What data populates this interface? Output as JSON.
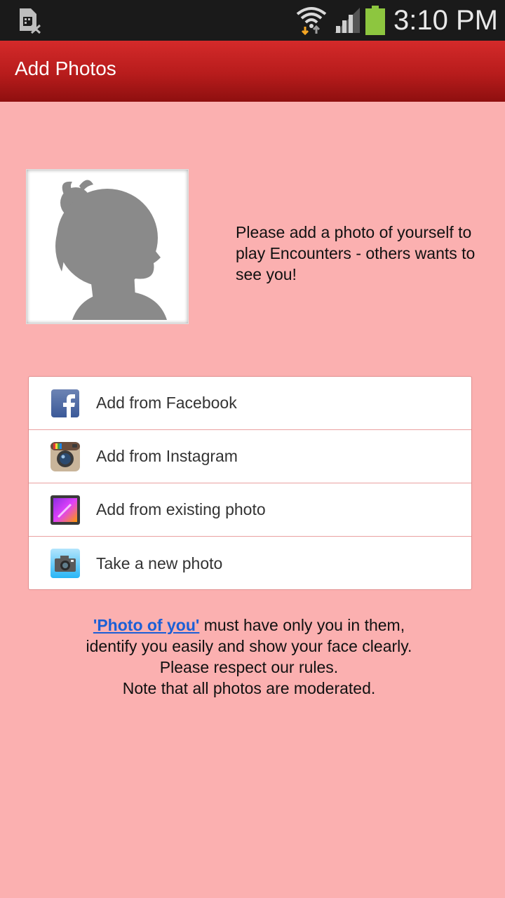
{
  "status_bar": {
    "time": "3:10 PM",
    "icons": [
      "sim-card-error-icon",
      "wifi-icon",
      "signal-icon",
      "battery-icon"
    ],
    "battery_color": "#8dc63f"
  },
  "action_bar": {
    "title": "Add Photos",
    "color": "#c62828"
  },
  "profile": {
    "placeholder_icon": "silhouette-icon",
    "prompt": "Please add a photo of yourself to play Encounters - others wants to see you!"
  },
  "options": [
    {
      "label": "Add from Facebook",
      "icon": "facebook-icon"
    },
    {
      "label": "Add from Instagram",
      "icon": "instagram-icon"
    },
    {
      "label": "Add from existing photo",
      "icon": "gallery-icon"
    },
    {
      "label": "Take a new photo",
      "icon": "camera-icon"
    }
  ],
  "rules": {
    "link_text": "'Photo of you'",
    "line1_rest": " must have only you in them,",
    "line2": "identify you easily and show your face clearly.",
    "line3": "Please respect our rules.",
    "line4": "Note that all photos are moderated.",
    "link_color": "#1b5fd6"
  }
}
